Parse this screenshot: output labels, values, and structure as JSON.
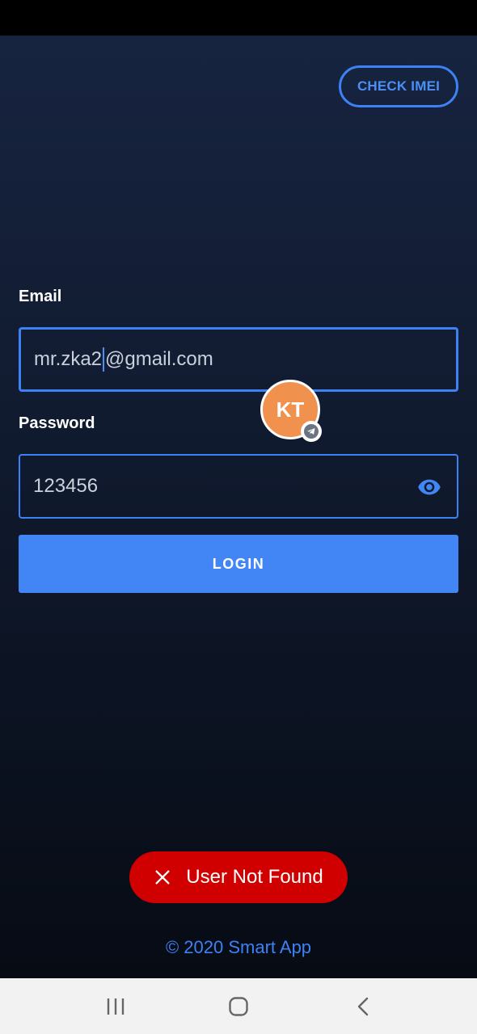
{
  "header": {
    "check_imei_label": "CHECK IMEI"
  },
  "form": {
    "email_label": "Email",
    "email_value_before_cursor": "mr.zka2",
    "email_value_after_cursor": "@gmail.com",
    "password_label": "Password",
    "password_value": "123456",
    "password_visibility_icon": "eye-icon",
    "login_label": "LOGIN"
  },
  "chat_head": {
    "initials": "KT",
    "badge_icon": "telegram-icon",
    "color": "#f0914e"
  },
  "toast": {
    "message": "User Not Found",
    "icon": "close-icon",
    "color": "#d00000"
  },
  "footer": {
    "copyright": "© 2020 Smart App"
  },
  "colors": {
    "accent": "#4286f5",
    "background_top": "#172440",
    "background_bottom": "#070b14"
  },
  "system_nav": {
    "recent_icon": "recent-apps-icon",
    "home_icon": "home-icon",
    "back_icon": "back-icon"
  }
}
